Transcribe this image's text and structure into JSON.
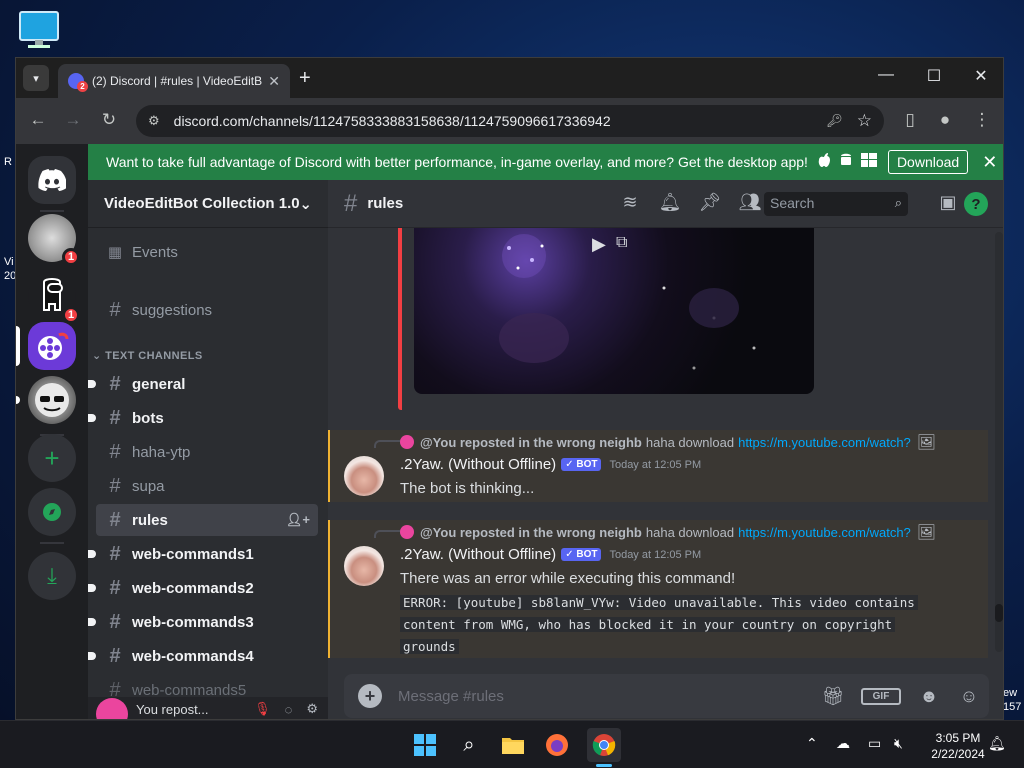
{
  "desktop": {
    "left_fragments": [
      "R",
      "Vi",
      "20"
    ],
    "right_fragments": [
      "ew",
      "157"
    ]
  },
  "browser": {
    "tab_title": "(2) Discord | #rules | VideoEditB",
    "tab_badge": "2",
    "url": "discord.com/channels/1124758333883158638/1124759096617336942"
  },
  "banner": {
    "text": "Want to take full advantage of Discord with better performance, in-game overlay, and more? Get the desktop app!",
    "download_label": "Download"
  },
  "servers": [
    {
      "name": "server-1",
      "badge": "1"
    },
    {
      "name": "server-2",
      "badge": "1"
    }
  ],
  "guild": {
    "name": "VideoEditBot Collection 1.0"
  },
  "channels": {
    "events_label": "Events",
    "suggestions": "suggestions",
    "category": "TEXT CHANNELS",
    "list": [
      {
        "name": "general",
        "state": "unread"
      },
      {
        "name": "bots",
        "state": "unread"
      },
      {
        "name": "haha-ytp",
        "state": "normal"
      },
      {
        "name": "supa",
        "state": "normal"
      },
      {
        "name": "rules",
        "state": "active"
      },
      {
        "name": "web-commands1",
        "state": "unread"
      },
      {
        "name": "web-commands2",
        "state": "unread"
      },
      {
        "name": "web-commands3",
        "state": "unread"
      },
      {
        "name": "web-commands4",
        "state": "unread"
      },
      {
        "name": "web-commands5",
        "state": "normal"
      }
    ]
  },
  "user": {
    "status": "You repost..."
  },
  "header": {
    "channel": "rules",
    "search_placeholder": "Search"
  },
  "messages": [
    {
      "reply_author": "@You reposted in the wrong neighb",
      "reply_text": "haha download",
      "reply_link": "https://m.youtube.com/watch?",
      "author": ".2Yaw. (Without Offline)",
      "bot_tag": "✓ BOT",
      "timestamp": "Today at 12:05 PM",
      "text": "The bot is thinking..."
    },
    {
      "reply_author": "@You reposted in the wrong neighb",
      "reply_text": "haha download",
      "reply_link": "https://m.youtube.com/watch?",
      "author": ".2Yaw. (Without Offline)",
      "bot_tag": "✓ BOT",
      "timestamp": "Today at 12:05 PM",
      "text": "There was an error while executing this command!",
      "code_lines": [
        "ERROR: [youtube] sb8lanW_VYw: Video unavailable. This video contains",
        "content from WMG, who has blocked it in your country on copyright",
        "grounds"
      ]
    }
  ],
  "composer": {
    "placeholder": "Message #rules",
    "gif_label": "GIF"
  },
  "taskbar": {
    "time": "3:05 PM",
    "date": "2/22/2024"
  },
  "colors": {
    "discord_blurple": "#5865f2",
    "banner_green": "#248046",
    "mention_bg": "#3a3733",
    "mention_border": "#f0b232",
    "link": "#00a8fc",
    "danger": "#f23f43"
  }
}
